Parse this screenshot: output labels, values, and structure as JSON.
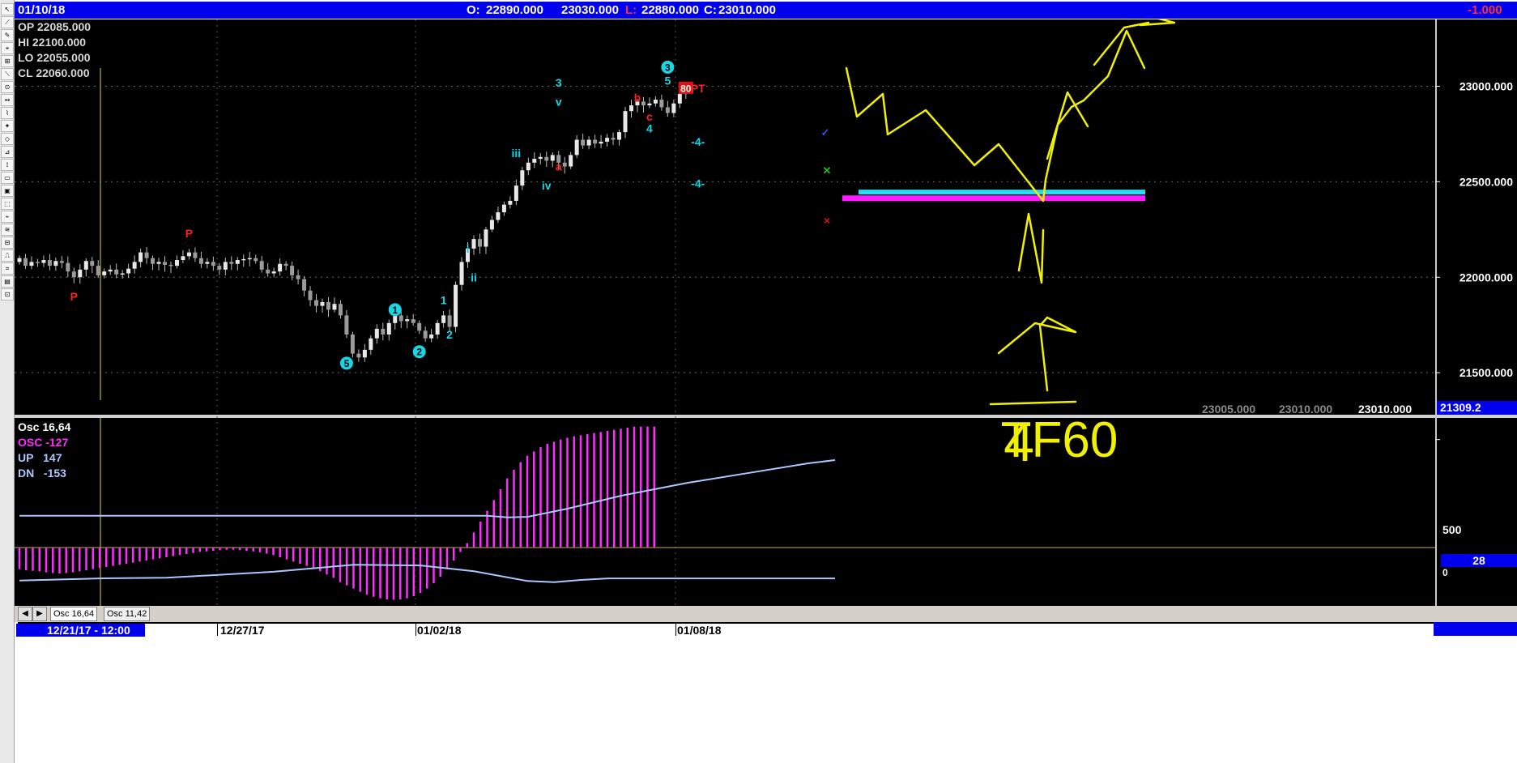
{
  "window": {
    "date": "01/10/18",
    "o_label": "O:",
    "o_value": "22890.000",
    "h_value": "23030.000",
    "l_label": "L:",
    "l_value": "22880.000",
    "c_label": "C:",
    "c_value": "23010.000",
    "change": "-1.000"
  },
  "ohlc": {
    "op_label": "OP",
    "op": "22085.000",
    "hi_label": "HI",
    "hi": "22100.000",
    "lo_label": "LO",
    "lo": "22055.000",
    "cl_label": "CL",
    "cl": "22060.000"
  },
  "footer_values": [
    "23005.000",
    "23010.000",
    "23010.000"
  ],
  "price_marker": "21309.2",
  "osc": {
    "title": "Osc 16,64",
    "osc_label": "OSC",
    "osc_value": "-127",
    "up_label": "UP",
    "up_value": "147",
    "dn_label": "DN",
    "dn_value": "-153",
    "marker": "28",
    "ytick_500": "500",
    "ytick_0": "0"
  },
  "tabs": [
    "Osc 16,64",
    "Osc 11,42"
  ],
  "time_axis": {
    "cursor": "12/21/17 - 12:00",
    "labels": [
      "12/27/17",
      "01/02/18",
      "01/08/18"
    ]
  },
  "annotation_text": [
    "4",
    "TF60"
  ],
  "colors": {
    "bg": "#000000",
    "bar": "#bdbdbd",
    "osc": "#ff2bff",
    "line": "#aac8ff",
    "wave": "#17d6e6",
    "abc": "#ff2020",
    "pen": "#f0f000",
    "titlebar": "#0000ee"
  },
  "chart_data": [
    {
      "type": "candlestick",
      "ylim": [
        21280,
        23350
      ],
      "yticks": [
        "21500.000",
        "22000.000",
        "22500.000",
        "23000.000"
      ],
      "ytick_values": [
        21500,
        22000,
        22500,
        23000
      ],
      "x_labels": [
        "12/27/17",
        "01/02/18",
        "01/08/18"
      ],
      "closes": [
        22100,
        22060,
        22080,
        22075,
        22090,
        22060,
        22085,
        22075,
        22030,
        22000,
        22040,
        22085,
        22060,
        22010,
        22030,
        22040,
        22015,
        22020,
        22045,
        22080,
        22130,
        22100,
        22070,
        22080,
        22065,
        22060,
        22090,
        22110,
        22130,
        22100,
        22070,
        22080,
        22060,
        22040,
        22080,
        22070,
        22090,
        22095,
        22100,
        22085,
        22040,
        22020,
        22030,
        22070,
        22060,
        22010,
        21990,
        21930,
        21880,
        21850,
        21870,
        21830,
        21860,
        21800,
        21700,
        21600,
        21580,
        21620,
        21680,
        21730,
        21700,
        21760,
        21800,
        21770,
        21780,
        21760,
        21720,
        21680,
        21700,
        21760,
        21800,
        21740,
        21960,
        22080,
        22150,
        22200,
        22160,
        22250,
        22300,
        22340,
        22380,
        22400,
        22480,
        22560,
        22600,
        22620,
        22630,
        22610,
        22640,
        22600,
        22580,
        22640,
        22720,
        22690,
        22720,
        22700,
        22710,
        22730,
        22720,
        22760,
        22870,
        22900,
        22920,
        22900,
        22910,
        22930,
        22890,
        22860,
        22910,
        22960,
        23010
      ],
      "markers": [
        {
          "text": "P",
          "kind": "abc",
          "i": 9,
          "price": 21900,
          "below": true
        },
        {
          "text": "P",
          "kind": "abc",
          "i": 28,
          "price": 22230,
          "below": false
        },
        {
          "text": "5",
          "kind": "wave_circle",
          "i": 54,
          "price": 21550,
          "below": true
        },
        {
          "text": "1",
          "kind": "wave_circle",
          "i": 62,
          "price": 21830,
          "below": false
        },
        {
          "text": "2",
          "kind": "wave_circle",
          "i": 66,
          "price": 21610,
          "below": true
        },
        {
          "text": "1",
          "kind": "wave",
          "i": 70,
          "price": 21880,
          "below": false
        },
        {
          "text": "2",
          "kind": "wave",
          "i": 71,
          "price": 21700,
          "below": true
        },
        {
          "text": "i",
          "kind": "wave",
          "i": 74,
          "price": 22150,
          "below": false
        },
        {
          "text": "ii",
          "kind": "wave",
          "i": 75,
          "price": 22000,
          "below": true
        },
        {
          "text": "iii",
          "kind": "wave",
          "i": 82,
          "price": 22650,
          "below": false
        },
        {
          "text": "iv",
          "kind": "wave",
          "i": 87,
          "price": 22480,
          "below": true
        },
        {
          "text": "3",
          "kind": "wave",
          "i": 89,
          "price": 23020,
          "below": false
        },
        {
          "text": "v",
          "kind": "wave",
          "i": 89,
          "price": 22920,
          "below": false
        },
        {
          "text": "a",
          "kind": "abc",
          "i": 89,
          "price": 22580,
          "below": true
        },
        {
          "text": "b",
          "kind": "abc",
          "i": 102,
          "price": 22940,
          "below": false
        },
        {
          "text": "c",
          "kind": "abc",
          "i": 104,
          "price": 22840,
          "below": true
        },
        {
          "text": "4",
          "kind": "wave",
          "i": 104,
          "price": 22780,
          "below": true
        },
        {
          "text": "5",
          "kind": "wave",
          "i": 107,
          "price": 23030,
          "below": false
        },
        {
          "text": "3",
          "kind": "wave_circle",
          "i": 107,
          "price": 23100,
          "below": false
        },
        {
          "text": "80",
          "kind": "box",
          "i": 110,
          "price": 22990,
          "below": false
        },
        {
          "text": "PT",
          "kind": "abc",
          "i": 112,
          "price": 22990,
          "below": false
        },
        {
          "text": "-4-",
          "kind": "wave",
          "i": 112,
          "price": 22710,
          "below": false
        },
        {
          "text": "-4-",
          "kind": "wave",
          "i": 112,
          "price": 22490,
          "below": false
        }
      ]
    },
    {
      "type": "bar",
      "ylim": [
        -270,
        600
      ],
      "yticks": [
        "500",
        "0"
      ],
      "series": [
        {
          "name": "OSC",
          "values": [
            -100,
            -105,
            -108,
            -110,
            -115,
            -118,
            -120,
            -118,
            -115,
            -110,
            -105,
            -100,
            -95,
            -90,
            -85,
            -80,
            -75,
            -70,
            -65,
            -60,
            -55,
            -50,
            -45,
            -40,
            -35,
            -30,
            -25,
            -20,
            -18,
            -15,
            -12,
            -10,
            -10,
            -12,
            -15,
            -18,
            -22,
            -28,
            -35,
            -45,
            -55,
            -65,
            -75,
            -85,
            -95,
            -110,
            -125,
            -140,
            -160,
            -175,
            -190,
            -205,
            -218,
            -228,
            -235,
            -240,
            -242,
            -240,
            -235,
            -225,
            -210,
            -190,
            -165,
            -135,
            -100,
            -60,
            -20,
            20,
            70,
            120,
            170,
            220,
            270,
            320,
            360,
            395,
            425,
            445,
            465,
            480,
            490,
            500,
            508,
            515,
            520,
            525,
            530,
            535,
            540,
            545,
            550,
            555,
            560,
            560,
            560,
            560
          ],
          "start": 0
        },
        {
          "name": "UP",
          "type": "line",
          "points": [
            [
              0,
              147
            ],
            [
              70,
              147
            ],
            [
              73,
              140
            ],
            [
              76,
              142
            ],
            [
              82,
              180
            ],
            [
              90,
              240
            ],
            [
              100,
              300
            ],
            [
              110,
              350
            ],
            [
              118,
              390
            ],
            [
              122,
              405
            ]
          ]
        },
        {
          "name": "DN",
          "type": "line",
          "points": [
            [
              0,
              -153
            ],
            [
              12,
              -143
            ],
            [
              22,
              -140
            ],
            [
              38,
              -112
            ],
            [
              50,
              -80
            ],
            [
              60,
              -83
            ],
            [
              68,
              -110
            ],
            [
              76,
              -155
            ],
            [
              80,
              -160
            ],
            [
              84,
              -150
            ],
            [
              88,
              -143
            ],
            [
              122,
              -143
            ]
          ]
        }
      ]
    }
  ]
}
